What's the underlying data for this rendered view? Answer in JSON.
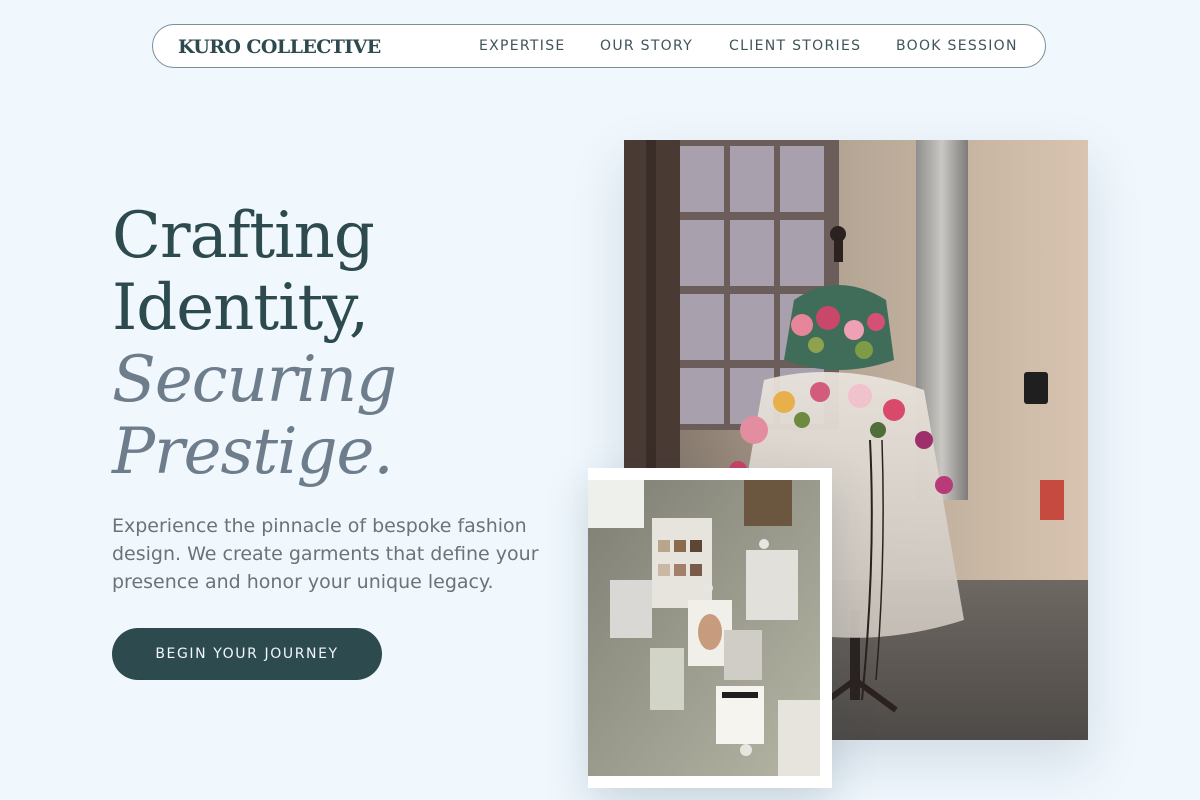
{
  "nav": {
    "brand": "KURO COLLECTIVE",
    "links": [
      "EXPERTISE",
      "OUR STORY",
      "CLIENT STORIES",
      "BOOK SESSION"
    ]
  },
  "hero": {
    "title_lines": [
      "Crafting",
      "Identity,",
      "Securing",
      "Prestige."
    ],
    "subtitle": "Experience the pinnacle of bespoke fashion design. We create garments that define your presence and honor your unique legacy.",
    "cta_label": "BEGIN YOUR JOURNEY"
  },
  "images": {
    "main_subject": "floral-gown-on-dress-form",
    "inset_subject": "fashion-moodboard-wall"
  },
  "colors": {
    "background": "#f0f7fd",
    "primary": "#2d4a4e",
    "accent_text": "#6e7d8c",
    "body_text": "#6a7478"
  }
}
